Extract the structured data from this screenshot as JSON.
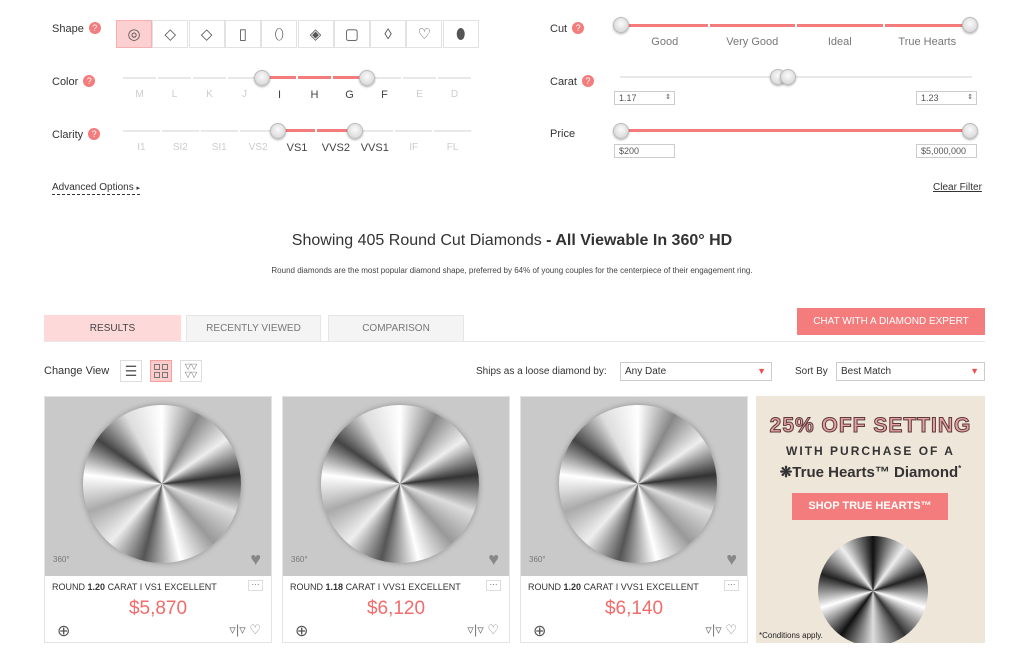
{
  "filters": {
    "shape": {
      "label": "Shape",
      "help": "?",
      "options": [
        "round",
        "princess",
        "cushion",
        "emerald",
        "oval",
        "asscher",
        "radiant",
        "marquise",
        "heart",
        "pear"
      ],
      "selected": "round"
    },
    "color": {
      "label": "Color",
      "help": "?",
      "grades": [
        "M",
        "L",
        "K",
        "J",
        "I",
        "H",
        "G",
        "F",
        "E",
        "D"
      ],
      "range": [
        "I",
        "F"
      ]
    },
    "clarity": {
      "label": "Clarity",
      "help": "?",
      "grades": [
        "I1",
        "SI2",
        "SI1",
        "VS2",
        "VS1",
        "VVS2",
        "VVS1",
        "IF",
        "FL"
      ],
      "range": [
        "VS1",
        "VVS1"
      ]
    },
    "cut": {
      "label": "Cut",
      "help": "?",
      "grades": [
        "Good",
        "Very Good",
        "Ideal",
        "True Hearts"
      ],
      "range": [
        "Good",
        "True Hearts"
      ]
    },
    "carat": {
      "label": "Carat",
      "help": "?",
      "min": "1.17",
      "max": "1.23"
    },
    "price": {
      "label": "Price",
      "min": "$200",
      "max": "$5,000,000"
    },
    "advanced": "Advanced Options",
    "clear": "Clear Filter"
  },
  "heading": {
    "count_text": "Showing 405 Round Cut Diamonds",
    "bold": " - All Viewable In 360° HD",
    "sub": "Round diamonds are the most popular diamond shape, preferred by 64% of young couples for the centerpiece of their engagement ring."
  },
  "tabs": [
    {
      "label": "RESULTS",
      "active": true
    },
    {
      "label": "RECENTLY VIEWED"
    },
    {
      "label": "COMPARISON"
    }
  ],
  "chat_button": "CHAT WITH A DIAMOND EXPERT",
  "toolbar": {
    "change_view": "Change View",
    "ships_label": "Ships as a loose diamond by:",
    "ships_value": "Any Date",
    "sort_label": "Sort By",
    "sort_value": "Best Match"
  },
  "products": [
    {
      "shape": "ROUND",
      "carat": "1.20",
      "rest": "CARAT I VS1 EXCELLENT",
      "price": "$5,870",
      "badge": "360°"
    },
    {
      "shape": "ROUND",
      "carat": "1.18",
      "rest": "CARAT I VVS1 EXCELLENT",
      "price": "$6,120",
      "badge": "360°"
    },
    {
      "shape": "ROUND",
      "carat": "1.20",
      "rest": "CARAT I VVS1 EXCELLENT",
      "price": "$6,140",
      "badge": "360°"
    }
  ],
  "ad": {
    "headline": "25% OFF SETTING",
    "line2": "WITH PURCHASE OF A",
    "line3": "True Hearts™ Diamond",
    "asterisk": "*",
    "button": "SHOP TRUE HEARTS™",
    "note": "*Conditions apply."
  },
  "colors": {
    "accent": "#f47c7c",
    "price": "#f36b6b",
    "tab_active": "#fdd9d9"
  }
}
